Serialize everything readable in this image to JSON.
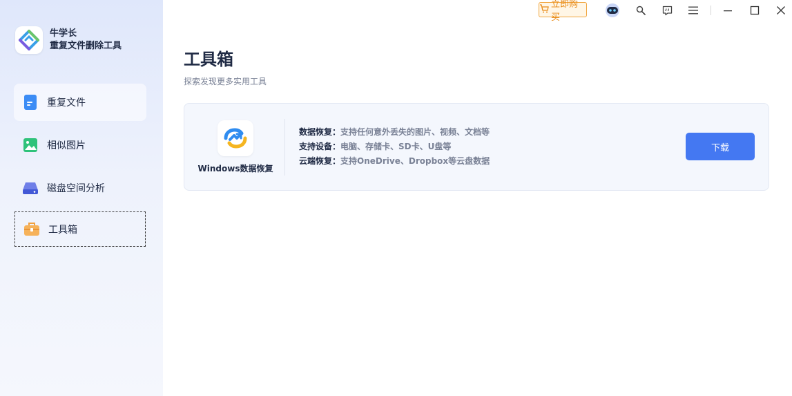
{
  "app": {
    "name": "牛学长",
    "subtitle": "重复文件删除工具"
  },
  "sidebar": {
    "items": [
      {
        "label": "重复文件",
        "icon": "document-icon"
      },
      {
        "label": "相似图片",
        "icon": "image-icon"
      },
      {
        "label": "磁盘空间分析",
        "icon": "disk-icon"
      },
      {
        "label": "工具箱",
        "icon": "toolbox-icon"
      }
    ]
  },
  "titlebar": {
    "buy_label": "立即购买",
    "icons": [
      "cart-icon",
      "robot-icon",
      "search-icon",
      "feedback-icon",
      "menu-icon",
      "minimize-icon",
      "maximize-icon",
      "close-icon"
    ]
  },
  "page": {
    "title": "工具箱",
    "subtitle": "探索发现更多实用工具"
  },
  "card": {
    "app_name": "Windows数据恢复",
    "features": [
      {
        "label": "数据恢复：",
        "text": "支持任何意外丢失的图片、视频、文档等"
      },
      {
        "label": "支持设备：",
        "text": "电脑、存储卡、SD卡、U盘等"
      },
      {
        "label": "云端恢复：",
        "text": "支持OneDrive、Dropbox等云盘数据"
      }
    ],
    "download_label": "下载"
  },
  "colors": {
    "accent": "#4478f2",
    "buy_orange": "#e88a16",
    "title_text": "#1f2a44",
    "muted_text": "#7a8296"
  }
}
